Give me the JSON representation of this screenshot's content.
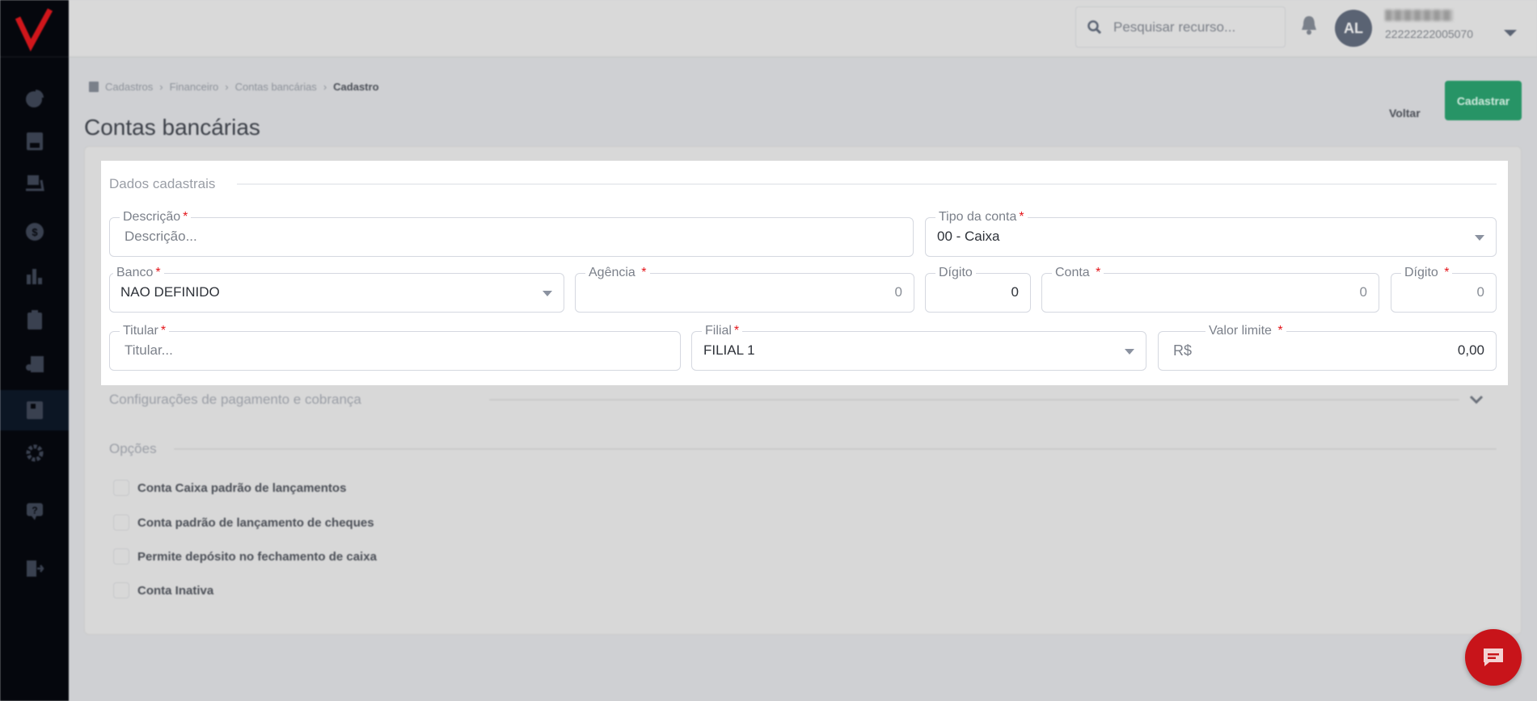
{
  "header": {
    "search_placeholder": "Pesquisar recurso...",
    "avatar_initials": "AL",
    "user_code": "22222222005070"
  },
  "breadcrumb": [
    "Cadastros",
    "Financeiro",
    "Contas bancárias",
    "Cadastro"
  ],
  "page": {
    "title": "Contas bancárias",
    "back_label": "Voltar",
    "submit_label": "Cadastrar"
  },
  "form": {
    "section1": "Dados cadastrais",
    "descricao": {
      "label": "Descrição",
      "placeholder": "Descrição..."
    },
    "tipo": {
      "label": "Tipo da conta",
      "value": "00 - Caixa"
    },
    "banco": {
      "label": "Banco",
      "value": "NAO DEFINIDO"
    },
    "agencia": {
      "label": "Agência",
      "value": "0"
    },
    "digito1": {
      "label": "Dígito",
      "value": "0"
    },
    "conta": {
      "label": "Conta",
      "value": "0"
    },
    "digito2": {
      "label": "Dígito",
      "value": "0"
    },
    "titular": {
      "label": "Titular",
      "placeholder": "Titular..."
    },
    "filial": {
      "label": "Filial",
      "value": "FILIAL 1"
    },
    "valor": {
      "label": "Valor limite",
      "prefix": "R$",
      "value": "0,00"
    },
    "required_mark": "*",
    "section2": "Configurações de pagamento e cobrança",
    "section3": "Opções",
    "options": [
      "Conta Caixa padrão de lançamentos",
      "Conta padrão de lançamento de cheques",
      "Permite depósito no fechamento de caixa",
      "Conta Inativa"
    ]
  },
  "colors": {
    "accent": "#279466",
    "brand": "#c8141a",
    "sidebar": "#05070d"
  }
}
